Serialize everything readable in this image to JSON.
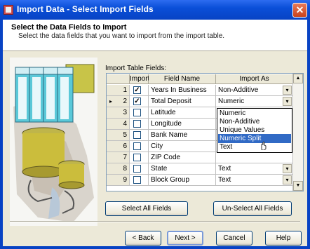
{
  "window": {
    "title": "Import Data - Select Import Fields",
    "close_glyph": "✕"
  },
  "header": {
    "title": "Select the Data Fields to Import",
    "subtitle": "Select the data fields that you want to import from the import table."
  },
  "grid": {
    "label": "Import Table Fields:",
    "columns": {
      "import": "Import",
      "field_name": "Field Name",
      "import_as": "Import As"
    },
    "rows": [
      {
        "num": "1",
        "checked": true,
        "field": "Years In Business",
        "import_as": "Non-Additive"
      },
      {
        "num": "2",
        "checked": true,
        "field": "Total Deposit",
        "import_as": "Numeric"
      },
      {
        "num": "3",
        "checked": false,
        "field": "Latitude",
        "import_as": ""
      },
      {
        "num": "4",
        "checked": false,
        "field": "Longitude",
        "import_as": ""
      },
      {
        "num": "5",
        "checked": false,
        "field": "Bank Name",
        "import_as": ""
      },
      {
        "num": "6",
        "checked": false,
        "field": "City",
        "import_as": ""
      },
      {
        "num": "7",
        "checked": false,
        "field": "ZIP Code",
        "import_as": ""
      },
      {
        "num": "8",
        "checked": false,
        "field": "State",
        "import_as": "Text"
      },
      {
        "num": "9",
        "checked": false,
        "field": "Block Group",
        "import_as": "Text"
      }
    ],
    "current_row_marker": "▸",
    "check_glyph": "✓",
    "dropdown_glyph": "▾"
  },
  "dropdown_options": [
    "Numeric",
    "Non-Additive",
    "Unique Values",
    "Numeric Split",
    "Text"
  ],
  "dropdown_selected": "Numeric Split",
  "illustration_icon": "database-table-icon",
  "buttons": {
    "select_all": "Select All Fields",
    "unselect_all": "Un-Select All Fields",
    "back": "< Back",
    "next": "Next >",
    "cancel": "Cancel",
    "help": "Help"
  },
  "colors": {
    "title_bar": "#0a4fd8",
    "selection": "#316ac5",
    "dialog_bg": "#ece9d8"
  }
}
